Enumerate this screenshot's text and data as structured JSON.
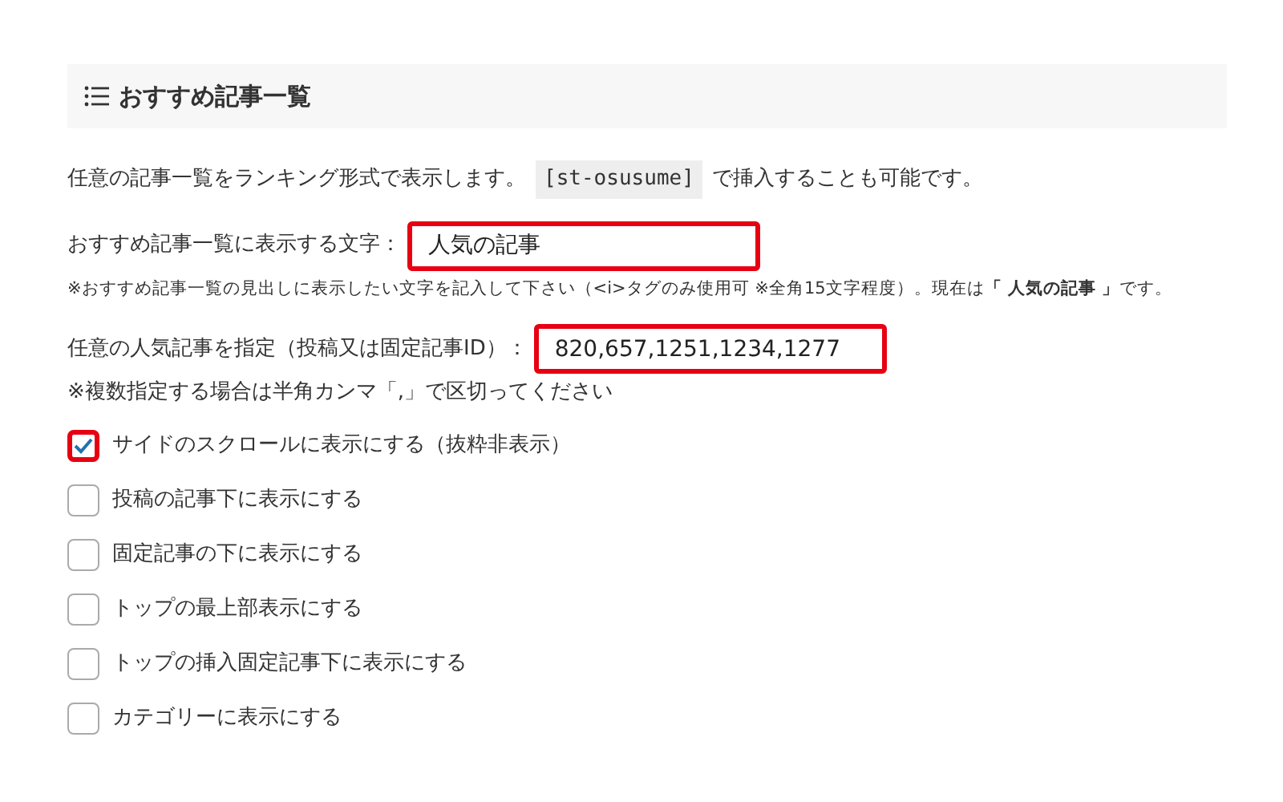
{
  "section": {
    "title": "おすすめ記事一覧"
  },
  "description": {
    "before": "任意の記事一覧をランキング形式で表示します。",
    "code": "[st-osusume]",
    "after": "で挿入することも可能です。"
  },
  "fields": [
    {
      "label": "おすすめ記事一覧に表示する文字：",
      "value": "人気の記事",
      "highlighted": true,
      "note": "※おすすめ記事一覧の見出しに表示したい文字を記入して下さい（<i>タグのみ使用可 ※全角15文字程度）。現在は**「 人気の記事 」**です。"
    },
    {
      "label": "任意の人気記事を指定（投稿又は固定記事ID）：",
      "value": "820,657,1251,1234,1277",
      "highlighted": true,
      "note": "※複数指定する場合は半角カンマ「,」で区切ってください"
    }
  ],
  "options": [
    {
      "label": "サイドのスクロールに表示にする（抜粋非表示）",
      "checked": true,
      "highlighted": true
    },
    {
      "label": "投稿の記事下に表示にする",
      "checked": false,
      "highlighted": false
    },
    {
      "label": "固定記事の下に表示にする",
      "checked": false,
      "highlighted": false
    },
    {
      "label": "トップの最上部表示にする",
      "checked": false,
      "highlighted": false
    },
    {
      "label": "トップの挿入固定記事下に表示にする",
      "checked": false,
      "highlighted": false
    },
    {
      "label": "カテゴリーに表示にする",
      "checked": false,
      "highlighted": false
    }
  ]
}
